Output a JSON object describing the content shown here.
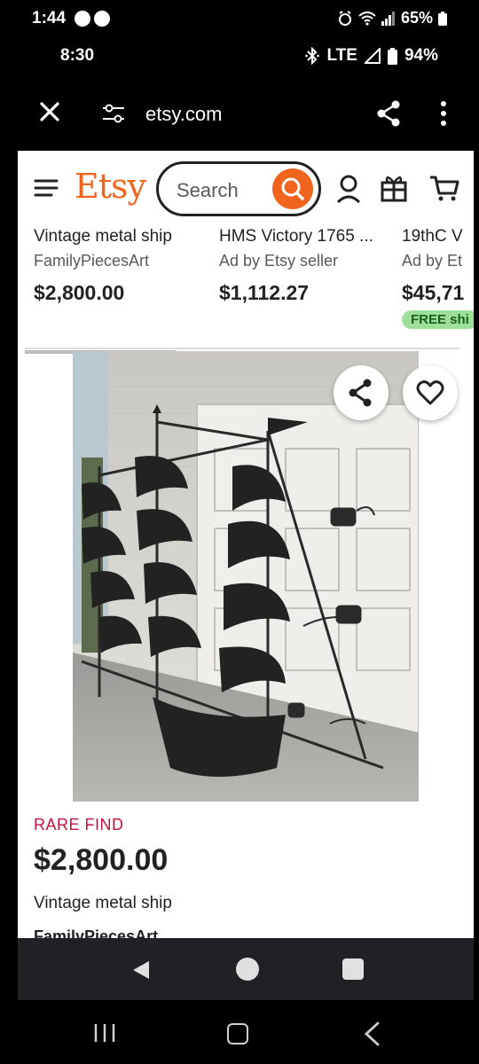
{
  "status_bar_top": {
    "time": "1:44",
    "battery": "65%"
  },
  "status_bar_secondary": {
    "time": "8:30",
    "network": "LTE",
    "battery": "94%"
  },
  "browser": {
    "url": "etsy.com"
  },
  "etsy_header": {
    "logo": "Etsy",
    "search_placeholder": "Search"
  },
  "recommendations": [
    {
      "title": "Vintage metal ship",
      "shop": "FamilyPiecesArt",
      "price": "$2,800.00"
    },
    {
      "title": "HMS Victory 1765 ...",
      "shop": "Ad by Etsy seller",
      "price": "$1,112.27"
    },
    {
      "title": "19thC V",
      "shop": "Ad by Et",
      "price": "$45,71",
      "badge": "FREE shi"
    }
  ],
  "listing": {
    "tag": "RARE FIND",
    "price": "$2,800.00",
    "title": "Vintage metal ship",
    "shop": "FamilyPiecesArt"
  },
  "colors": {
    "brand": "#f1641e",
    "rare": "#c4143c",
    "free_shipping_bg": "#9ee097"
  },
  "icons": [
    "facebook-messenger-icon",
    "facebook-icon",
    "alarm-icon",
    "wifi-icon",
    "signal-icon",
    "battery-icon",
    "bluetooth-icon",
    "close-icon",
    "tune-icon",
    "share-icon",
    "more-vert-icon",
    "menu-icon",
    "search-icon",
    "user-icon",
    "gift-icon",
    "cart-icon",
    "heart-icon"
  ]
}
